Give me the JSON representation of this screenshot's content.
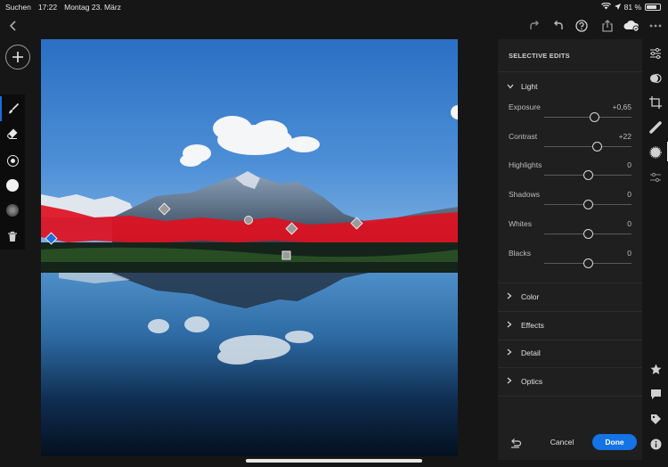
{
  "status": {
    "back_label": "Suchen",
    "time": "17:22",
    "date": "Montag 23. März",
    "battery": "81 %",
    "battery_level": 0.81
  },
  "toolbar": {
    "icons": [
      "back-chevron-icon",
      "redo-icon",
      "undo-icon",
      "help-icon",
      "share-icon",
      "cloud-sync-icon",
      "more-icon"
    ]
  },
  "tools": [
    "brush-icon",
    "eraser-icon",
    "brush-size-icon",
    "brush-feather-icon",
    "brush-flow-icon",
    "delete-icon"
  ],
  "panel": {
    "title": "SELECTIVE EDITS",
    "light": {
      "label": "Light",
      "sliders": [
        {
          "name": "Exposure",
          "value": "+0,65",
          "num": 0.65,
          "min": -4,
          "max": 4
        },
        {
          "name": "Contrast",
          "value": "+22",
          "num": 22,
          "min": -100,
          "max": 100
        },
        {
          "name": "Highlights",
          "value": "0",
          "num": 0,
          "min": -100,
          "max": 100
        },
        {
          "name": "Shadows",
          "value": "0",
          "num": 0,
          "min": -100,
          "max": 100
        },
        {
          "name": "Whites",
          "value": "0",
          "num": 0,
          "min": -100,
          "max": 100
        },
        {
          "name": "Blacks",
          "value": "0",
          "num": 0,
          "min": -100,
          "max": 100
        }
      ]
    },
    "sections": [
      "Color",
      "Effects",
      "Detail",
      "Optics"
    ],
    "cancel_label": "Cancel",
    "done_label": "Done"
  },
  "right_rail": [
    "edit-sliders-icon",
    "masking-icon",
    "crop-icon",
    "healing-icon",
    "selective-edits-icon",
    "versions-icon",
    "star-icon",
    "comment-icon",
    "tag-icon",
    "info-icon"
  ]
}
